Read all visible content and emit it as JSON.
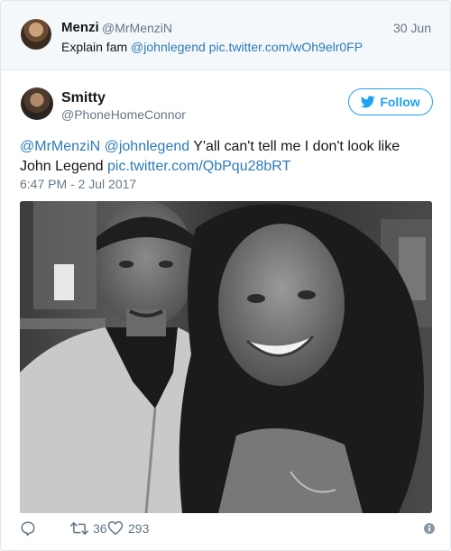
{
  "parent_tweet": {
    "name": "Menzi",
    "handle": "@MrMenziN",
    "date": "30 Jun",
    "text_prefix": "Explain fam ",
    "mention": "@johnlegend",
    "link": "pic.twitter.com/wOh9elr0FP"
  },
  "tweet": {
    "name": "Smitty",
    "handle": "@PhoneHomeConnor",
    "follow_label": "Follow",
    "mention1": "@MrMenziN",
    "mention2": "@johnlegend",
    "text_body": " Y'all can't tell me I don't look like John Legend ",
    "link": "pic.twitter.com/QbPqu28bRT",
    "timestamp": "6:47 PM - 2 Jul 2017",
    "retweet_count": "36",
    "like_count": "293"
  },
  "colors": {
    "link": "#2b7bb9",
    "brand": "#1da1f2",
    "muted": "#657786"
  },
  "icons": [
    "twitter-bird-icon",
    "reply-icon",
    "retweet-icon",
    "heart-icon",
    "info-icon"
  ]
}
